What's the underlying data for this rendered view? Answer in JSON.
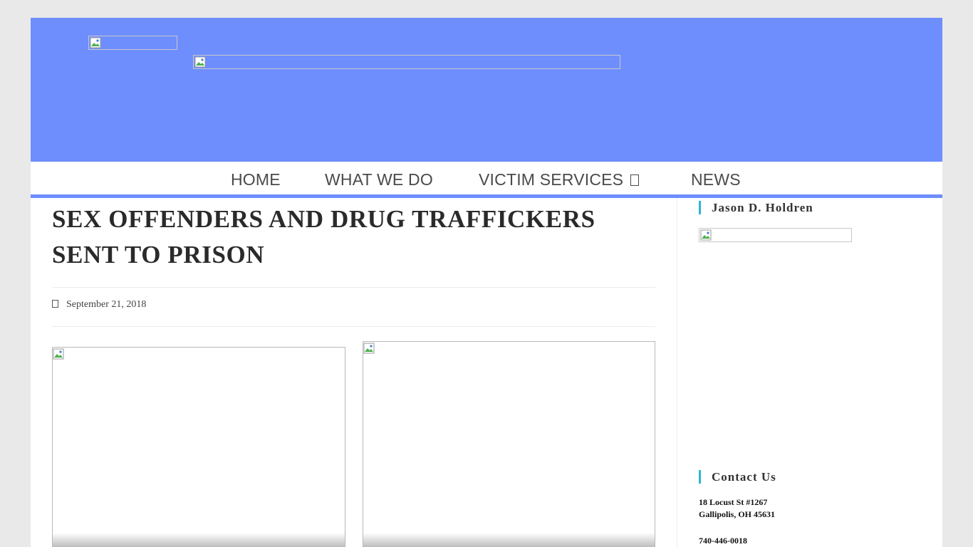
{
  "nav": {
    "items": [
      {
        "label": "HOME"
      },
      {
        "label": "WHAT WE DO"
      },
      {
        "label": "VICTIM SERVICES"
      },
      {
        "label": "NEWS"
      }
    ]
  },
  "article": {
    "title": "SEX OFFENDERS AND DRUG TRAFFICKERS SENT TO PRISON",
    "date": "September 21, 2018"
  },
  "sidebar": {
    "widget_1_title": "Jason D. Holdren",
    "widget_2_title": "Contact Us",
    "address_line_1": "18 Locust St #1267",
    "address_line_2": "Gallipolis, OH 45631",
    "phone": "740-446-0018"
  },
  "colors": {
    "header_background": "#6e8efd",
    "nav_underline": "#6e8efd",
    "widget_accent": "#2bb6d6",
    "page_background": "#e9e9e9"
  },
  "icons": {
    "nav_dropdown": "chevron-down-icon",
    "date": "calendar-icon",
    "broken_image": "broken-image-icon"
  }
}
